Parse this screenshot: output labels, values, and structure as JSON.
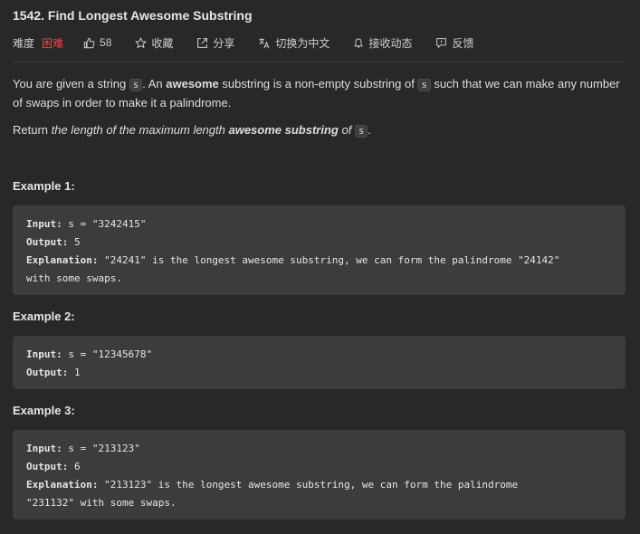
{
  "problem": {
    "title": "1542. Find Longest Awesome Substring"
  },
  "meta": {
    "difficulty_label": "难度",
    "difficulty_value": "困难",
    "likes": "58",
    "favorite_label": "收藏",
    "share_label": "分享",
    "translate_label": "切换为中文",
    "notify_label": "接收动态",
    "feedback_label": "反馈"
  },
  "description": {
    "p1_a": "You are given a string ",
    "code_s": "s",
    "p1_b": ". An ",
    "p1_awesome": "awesome",
    "p1_c": " substring is a non-empty substring of ",
    "p1_d": " such that we can make any number of swaps in order to make it a palindrome.",
    "p2_a": "Return ",
    "p2_em1": "the length of the maximum length ",
    "p2_strong": "awesome substring",
    "p2_em2": " of ",
    "p2_end": "."
  },
  "examples": [
    {
      "heading": "Example 1:",
      "input_label": "Input:",
      "input_value": " s = \"3242415\"",
      "output_label": "Output:",
      "output_value": " 5",
      "explanation_label": "Explanation:",
      "explanation_line1": " \"24241\" is the longest awesome substring, we can form the palindrome \"24142\"",
      "explanation_line2": "with some swaps."
    },
    {
      "heading": "Example 2:",
      "input_label": "Input:",
      "input_value": " s = \"12345678\"",
      "output_label": "Output:",
      "output_value": " 1"
    },
    {
      "heading": "Example 3:",
      "input_label": "Input:",
      "input_value": " s = \"213123\"",
      "output_label": "Output:",
      "output_value": " 6",
      "explanation_label": "Explanation:",
      "explanation_line1": " \"213123\" is the longest awesome substring, we can form the palindrome",
      "explanation_line2": "\"231132\" with some swaps."
    }
  ],
  "colors": {
    "background": "#282828",
    "difficulty_hard": "#ef4743",
    "example_box": "#3c3c3c"
  },
  "icons": {
    "likes": "thumbs-up-icon",
    "favorite": "star-icon",
    "share": "share-icon",
    "translate": "translate-icon",
    "notify": "bell-icon",
    "feedback": "feedback-icon"
  }
}
